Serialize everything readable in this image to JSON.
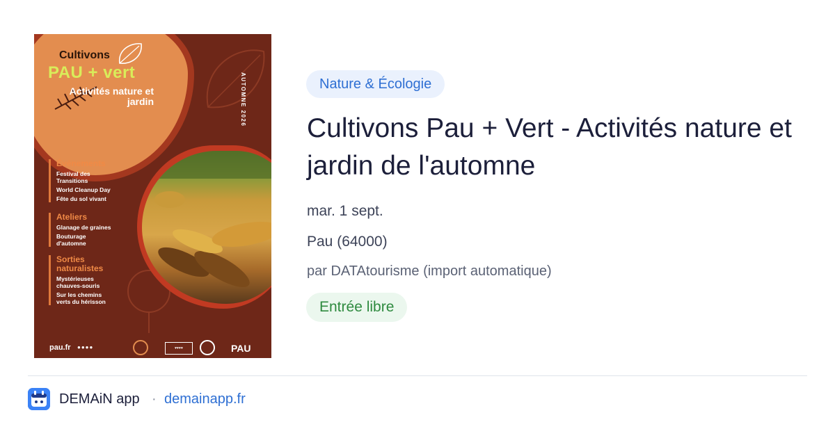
{
  "poster": {
    "title_line1": "Cultivons",
    "title_line2": "PAU + vert",
    "subtitle": "Activités nature et jardin",
    "season": "AUTOMNE 2026",
    "sections": [
      {
        "heading": "Événements",
        "items": [
          "Festival des Transitions",
          "World Cleanup Day",
          "Fête du sol vivant"
        ]
      },
      {
        "heading": "Ateliers",
        "items": [
          "Glanage de graines",
          "Bouturage d'automne"
        ]
      },
      {
        "heading": "Sorties naturalistes",
        "items": [
          "Mystérieuses chauves-souris",
          "Sur les chemins verts du hérisson"
        ]
      }
    ],
    "footer_url": "pau.fr",
    "footer_logo": "PAU",
    "photo_subject": "corn harvest",
    "colors": {
      "background": "#6e2718",
      "accent": "#e38d4f",
      "title_green": "#d9ec5a"
    }
  },
  "category": "Nature & Écologie",
  "title": "Cultivons Pau + Vert - Activités nature et jardin de l'automne",
  "date": "mar. 1 sept.",
  "location": "Pau (64000)",
  "organizer": "par DATAtourisme (import automatique)",
  "price": "Entrée libre",
  "footer": {
    "app_name": "DEMAiN app",
    "separator": "·",
    "url": "demainapp.fr",
    "app_icon": "app-logo-icon"
  },
  "colors": {
    "link": "#2e6fd3",
    "category_bg": "#eaf1fd",
    "price_bg": "#ebf7ee",
    "price_text": "#2e8a3f"
  }
}
